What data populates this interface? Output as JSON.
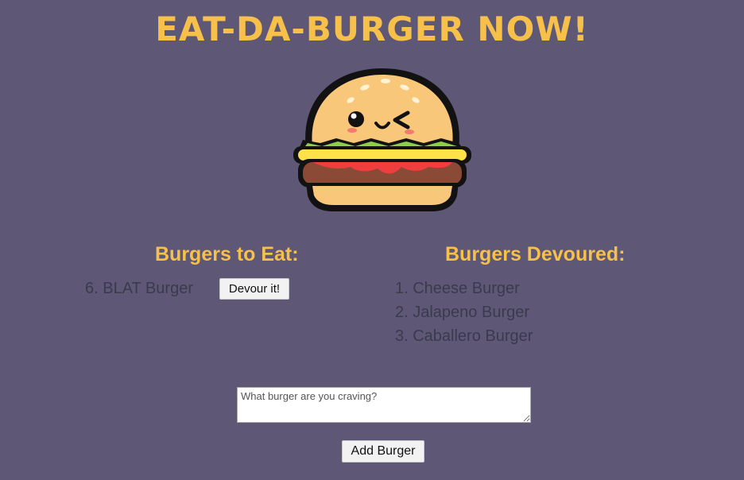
{
  "header": {
    "title": "EAT-DA-BURGER NOW!"
  },
  "logo": {
    "icon": "burger-mascot-icon"
  },
  "to_eat": {
    "heading": "Burgers to Eat:",
    "items": [
      {
        "label": "6. BLAT Burger",
        "action_label": "Devour it!"
      }
    ]
  },
  "devoured": {
    "heading": "Burgers Devoured:",
    "items": [
      {
        "label": "1. Cheese Burger"
      },
      {
        "label": "2. Jalapeno Burger"
      },
      {
        "label": "3. Caballero Burger"
      }
    ]
  },
  "form": {
    "placeholder": "What burger are you craving?",
    "value": "",
    "submit_label": "Add Burger"
  },
  "colors": {
    "background": "#5e5876",
    "accent": "#f7c04a",
    "text": "#3a3a4e"
  }
}
